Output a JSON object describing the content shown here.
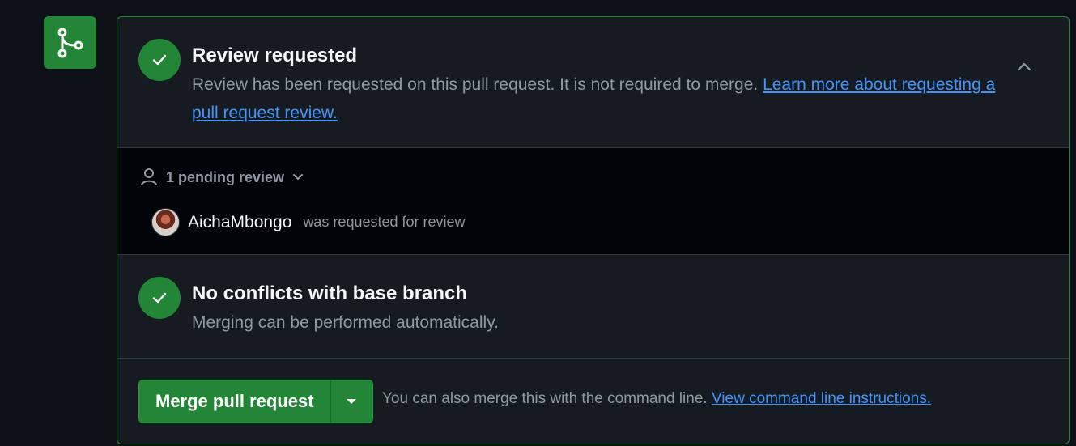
{
  "colors": {
    "background": "#0d1117",
    "panel": "#161b22",
    "success": "#238636",
    "link": "#4493f8",
    "muted": "#9198a1"
  },
  "review": {
    "title": "Review requested",
    "description": "Review has been requested on this pull request. It is not required to merge. ",
    "link_text": "Learn more about requesting a pull request review.",
    "collapse_icon": "chevron-up-icon"
  },
  "pending": {
    "label": "1 pending review",
    "icon": "person-icon",
    "reviewers": [
      {
        "name": "AichaMbongo",
        "status": "was requested for review"
      }
    ]
  },
  "conflicts": {
    "title": "No conflicts with base branch",
    "description": "Merging can be performed automatically."
  },
  "merge": {
    "button_label": "Merge pull request",
    "hint": "You can also merge this with the command line. ",
    "link_text": "View command line instructions."
  }
}
